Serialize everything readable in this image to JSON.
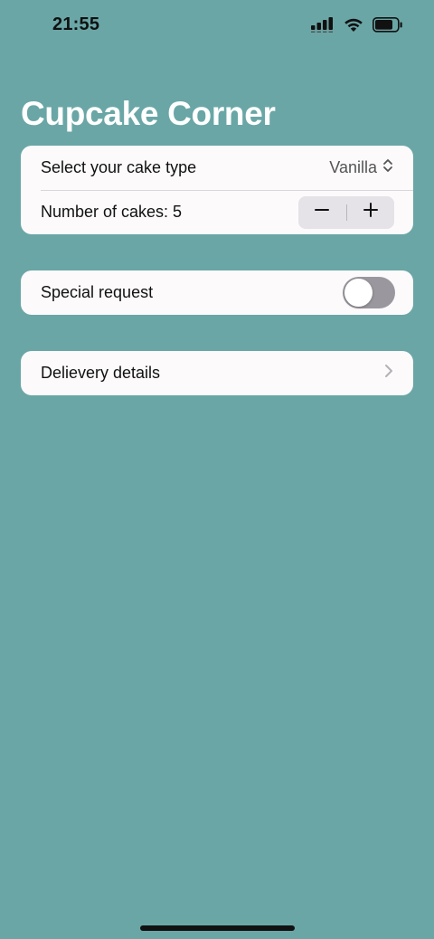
{
  "status_bar": {
    "time": "21:55",
    "icons": [
      "cellular-signal-icon",
      "wifi-icon",
      "battery-icon"
    ]
  },
  "page": {
    "title": "Cupcake Corner"
  },
  "order_section": {
    "cake_type_label": "Select your cake type",
    "cake_type_value": "Vanilla",
    "quantity_label": "Number of cakes: 5",
    "stepper_decrement": "−",
    "stepper_increment": "+"
  },
  "special_section": {
    "special_request_label": "Special request",
    "special_request_enabled": false
  },
  "delivery_section": {
    "delivery_label": "Delievery details"
  },
  "colors": {
    "background": "#6aa6a6",
    "card": "#fcfafb",
    "title": "#ffffff"
  }
}
